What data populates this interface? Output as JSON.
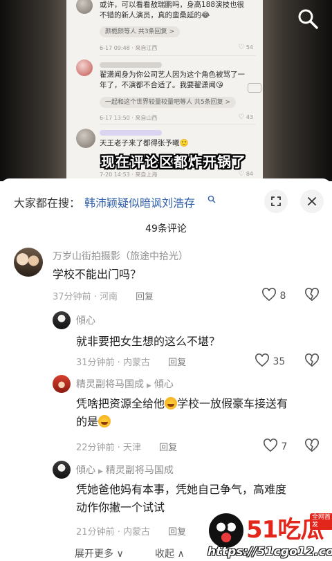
{
  "video": {
    "subtitle": "现在评论区都炸开锅了",
    "embedded_comments": [
      {
        "text": "或许，可以看看敖瑞鹏吗，身高188演技也很不错的新人演员，真的蛮桑延的😂",
        "replies": "颜栀颜等人 共3条回复 >",
        "meta": "6-17 09:48 · 来自江西",
        "likes": "54"
      },
      {
        "text": "翟潇闻身为你公司艺人因为这个角色被骂了一年了，不演都不合适了。我要翟潇闻😘",
        "replies": "一起和这个世界较量较量吧等人 共5条回复 >",
        "meta": "6-17 13:50 · 来自山西",
        "likes": "43"
      },
      {
        "text": "天王老子来了都得张予曦🙂",
        "meta": "7-20 14:53 · 来自上海",
        "likes": "84"
      }
    ]
  },
  "search": {
    "prefix": "大家都在搜：",
    "query": "韩沛颖疑似暗讽刘浩存"
  },
  "icons": {
    "search_glass": "search-icon",
    "expand": "expand-icon",
    "close": "close-icon",
    "like": "heart-icon",
    "dislike": "broken-heart-icon"
  },
  "comment_count": "49条评论",
  "comments": [
    {
      "user": "万岁山街拍摄影（旅途中拾光）",
      "body": "学校不能出门吗？",
      "time_place": "37分钟前 · 河南",
      "reply_label": "回复",
      "likes": "8"
    },
    {
      "user": "傾心",
      "body": "就非要把女生想的这么不堪？",
      "time_place": "31分钟前 · 内蒙古",
      "reply_label": "回复",
      "likes": "35"
    },
    {
      "user": "精灵副将马国成",
      "reply_to": "傾心",
      "body_a": "凭啥把资源全给他",
      "body_b": "学校一放假豪车接送有",
      "body_c": "的是",
      "time_place": "22分钟前 · 天津",
      "reply_label": "回复",
      "likes": "7"
    },
    {
      "user": "傾心",
      "reply_to": "精灵副将马国成",
      "body_line1": "凭她爸他妈有本事，凭她自己争气，高难度",
      "body_line2": "动作你撇一个试试",
      "time_place": "21分钟前 · 内蒙古",
      "reply_label": "回复"
    }
  ],
  "footer": {
    "expand_more": "展开更多 ∨",
    "collapse": "收起 ∧"
  },
  "watermark": {
    "logo": "51吃瓜",
    "tag": "全网首发",
    "url": "https://51cgo12.com"
  },
  "colors": {
    "link_blue": "#2f5ea8",
    "watermark_red": "#e3261c"
  }
}
